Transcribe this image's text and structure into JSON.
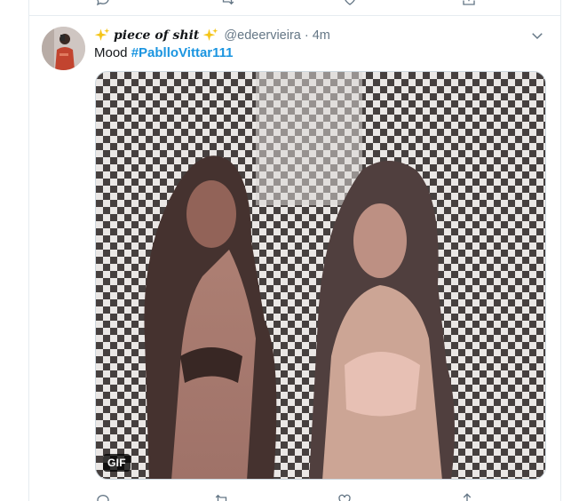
{
  "tweet": {
    "display_name": "piece of shit",
    "display_name_emoji": "sparkles-icon",
    "handle": "@edeervieira",
    "separator": "·",
    "time": "4m",
    "text_prefix": "Mood ",
    "hashtag": "#PablloVittar111",
    "media_badge": "GIF"
  },
  "colors": {
    "link": "#1b95e0",
    "secondary_text": "#657786",
    "border": "#e6ecf0",
    "sparkle": "#f5c518"
  },
  "icons": [
    "reply-icon",
    "retweet-icon",
    "like-icon",
    "share-icon",
    "chevron-down-icon",
    "sparkles-icon"
  ]
}
